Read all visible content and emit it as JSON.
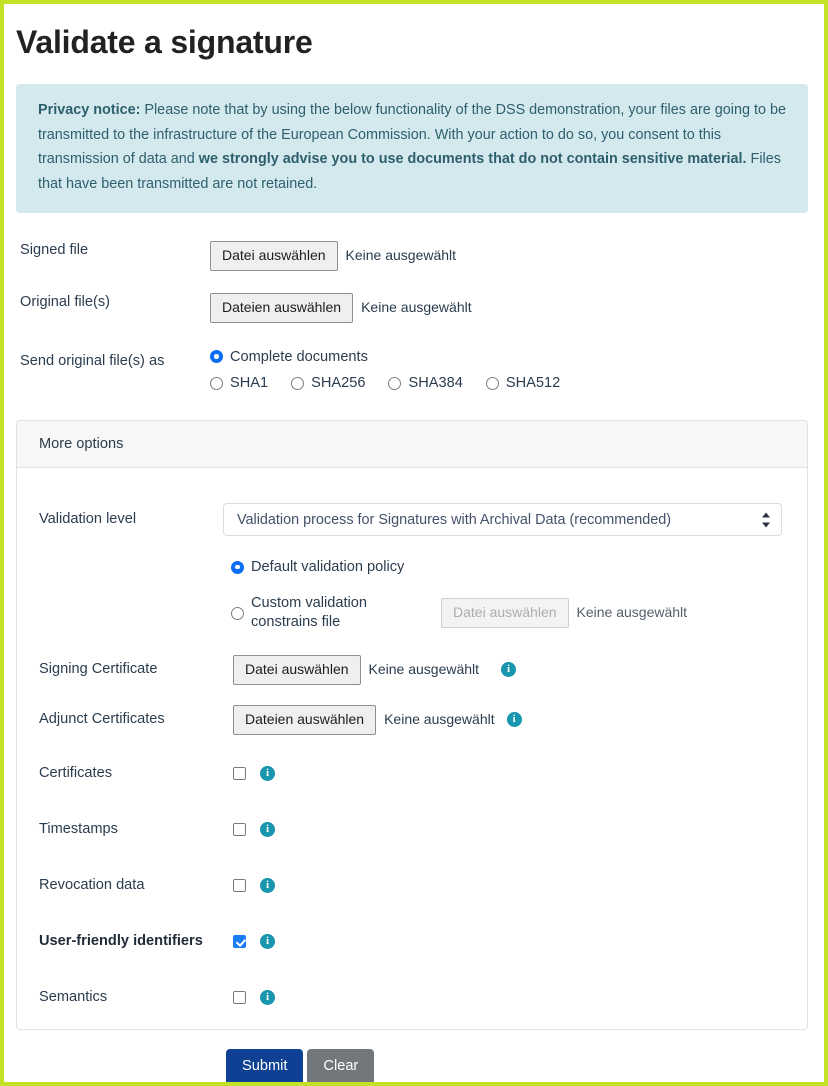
{
  "page": {
    "title": "Validate a signature",
    "accent_border_color": "#c3e225",
    "accent_blue": "#0e4194",
    "info_icon_color": "#1796ae"
  },
  "privacy_notice": {
    "label": "Privacy notice:",
    "text_part1": " Please note that by using the below functionality of the DSS demonstration, your files are going to be transmitted to the infrastructure of the European Commission. With your action to do so, you consent to this transmission of data and ",
    "emphasis": "we strongly advise you to use documents that do not contain sensitive material.",
    "text_part2": " Files that have been transmitted are not retained.",
    "background_color": "#d4e9ee",
    "text_color": "#2e5f6d"
  },
  "form": {
    "signed_file": {
      "label": "Signed file",
      "button_label": "Datei auswählen",
      "file_status": "Keine ausgewählt"
    },
    "original_files": {
      "label": "Original file(s)",
      "button_label": "Dateien auswählen",
      "file_status": "Keine ausgewählt"
    },
    "send_original_as": {
      "label": "Send original file(s) as",
      "options": [
        {
          "label": "Complete documents",
          "checked": true
        },
        {
          "label": "SHA1",
          "checked": false
        },
        {
          "label": "SHA256",
          "checked": false
        },
        {
          "label": "SHA384",
          "checked": false
        },
        {
          "label": "SHA512",
          "checked": false
        }
      ]
    }
  },
  "more_options": {
    "header": "More options",
    "validation_level": {
      "label": "Validation level",
      "selected": "Validation process for Signatures with Archival Data (recommended)"
    },
    "validation_policy": {
      "default": {
        "label": "Default validation policy",
        "checked": true
      },
      "custom": {
        "label_line1": "Custom validation",
        "label_line2": "constrains file",
        "checked": false,
        "button_label": "Datei auswählen",
        "file_status": "Keine ausgewählt",
        "disabled": true
      }
    },
    "signing_certificate": {
      "label": "Signing Certificate",
      "button_label": "Datei auswählen",
      "file_status": "Keine ausgewählt",
      "info": "i"
    },
    "adjunct_certificates": {
      "label": "Adjunct Certificates",
      "button_label": "Dateien auswählen",
      "file_status": "Keine ausgewählt",
      "info": "i"
    },
    "checkboxes": [
      {
        "label": "Certificates",
        "checked": false,
        "bold": false,
        "info": "i"
      },
      {
        "label": "Timestamps",
        "checked": false,
        "bold": false,
        "info": "i"
      },
      {
        "label": "Revocation data",
        "checked": false,
        "bold": false,
        "info": "i"
      },
      {
        "label": "User-friendly identifiers",
        "checked": true,
        "bold": true,
        "info": "i"
      },
      {
        "label": "Semantics",
        "checked": false,
        "bold": false,
        "info": "i"
      }
    ]
  },
  "actions": {
    "submit_label": "Submit",
    "clear_label": "Clear"
  }
}
